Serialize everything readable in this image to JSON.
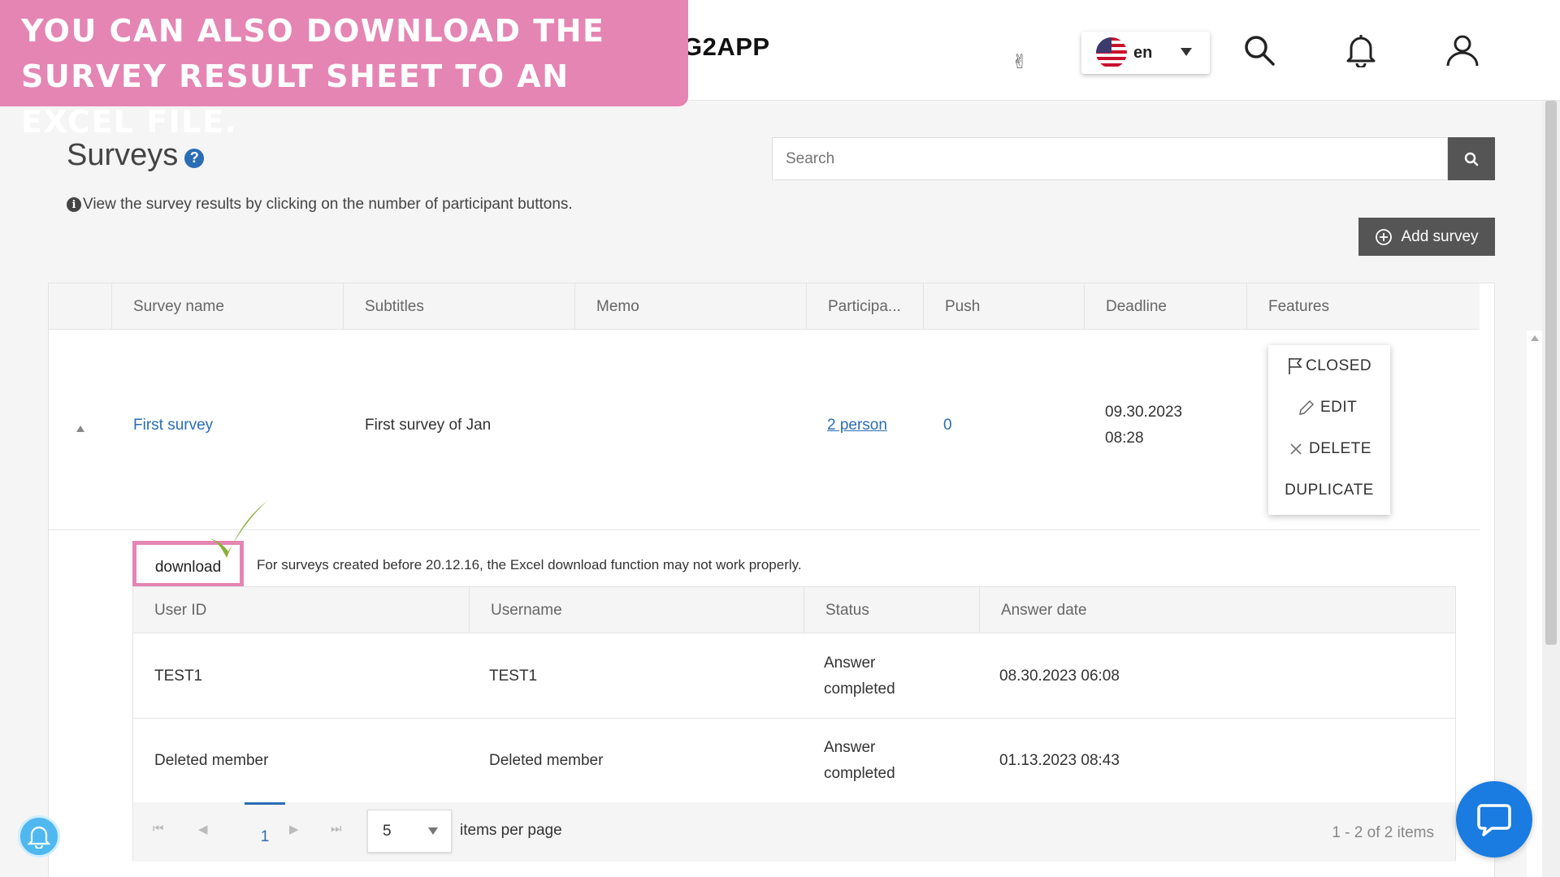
{
  "banner": {
    "text": "You can also download the survey result sheet to an Excel file."
  },
  "header": {
    "brand": "G2APP",
    "language": {
      "flag": "us-flag-icon",
      "code": "en"
    },
    "icons": [
      "victory-hand-icon",
      "search-icon",
      "bell-icon",
      "user-icon"
    ]
  },
  "page": {
    "title": "Surveys",
    "help_icon": "?",
    "info_text": "View the survey results by clicking on the number of participant buttons."
  },
  "search": {
    "placeholder": "Search",
    "value": ""
  },
  "add_survey": {
    "label": "Add survey"
  },
  "survey_table": {
    "columns": [
      "Survey name",
      "Subtitles",
      "Memo",
      "Participa...",
      "Push",
      "Deadline",
      "Features"
    ],
    "rows": [
      {
        "name": "First survey",
        "subtitle": "First survey of Jan",
        "memo": "",
        "participants": "2 person",
        "push": "0",
        "deadline_date": "09.30.2023",
        "deadline_time": "08:28"
      }
    ]
  },
  "features_menu": {
    "items": [
      {
        "label": "CLOSED",
        "icon": "flag-icon"
      },
      {
        "label": "EDIT",
        "icon": "pencil-icon"
      },
      {
        "label": "DELETE",
        "icon": "x-icon"
      },
      {
        "label": "DUPLICATE",
        "icon": ""
      }
    ]
  },
  "download": {
    "label": "download",
    "note": "For surveys created before 20.12.16, the Excel download function may not work properly."
  },
  "results_table": {
    "columns": [
      "User ID",
      "Username",
      "Status",
      "Answer date"
    ],
    "rows": [
      {
        "user_id": "TEST1",
        "username": "TEST1",
        "status_line1": "Answer",
        "status_line2": "completed",
        "answer_date": "08.30.2023 06:08"
      },
      {
        "user_id": "Deleted member",
        "username": "Deleted member",
        "status_line1": "Answer",
        "status_line2": "completed",
        "answer_date": "01.13.2023 08:43"
      }
    ]
  },
  "pager": {
    "current_page": "1",
    "page_size": "5",
    "page_size_label": "items per page",
    "info": "1 - 2 of 2 items"
  },
  "colors": {
    "banner": "#e585b3",
    "link": "#2a6db5",
    "dark_button": "#555555",
    "checkmark": "#8bb03a",
    "chat": "#1a7be0"
  }
}
